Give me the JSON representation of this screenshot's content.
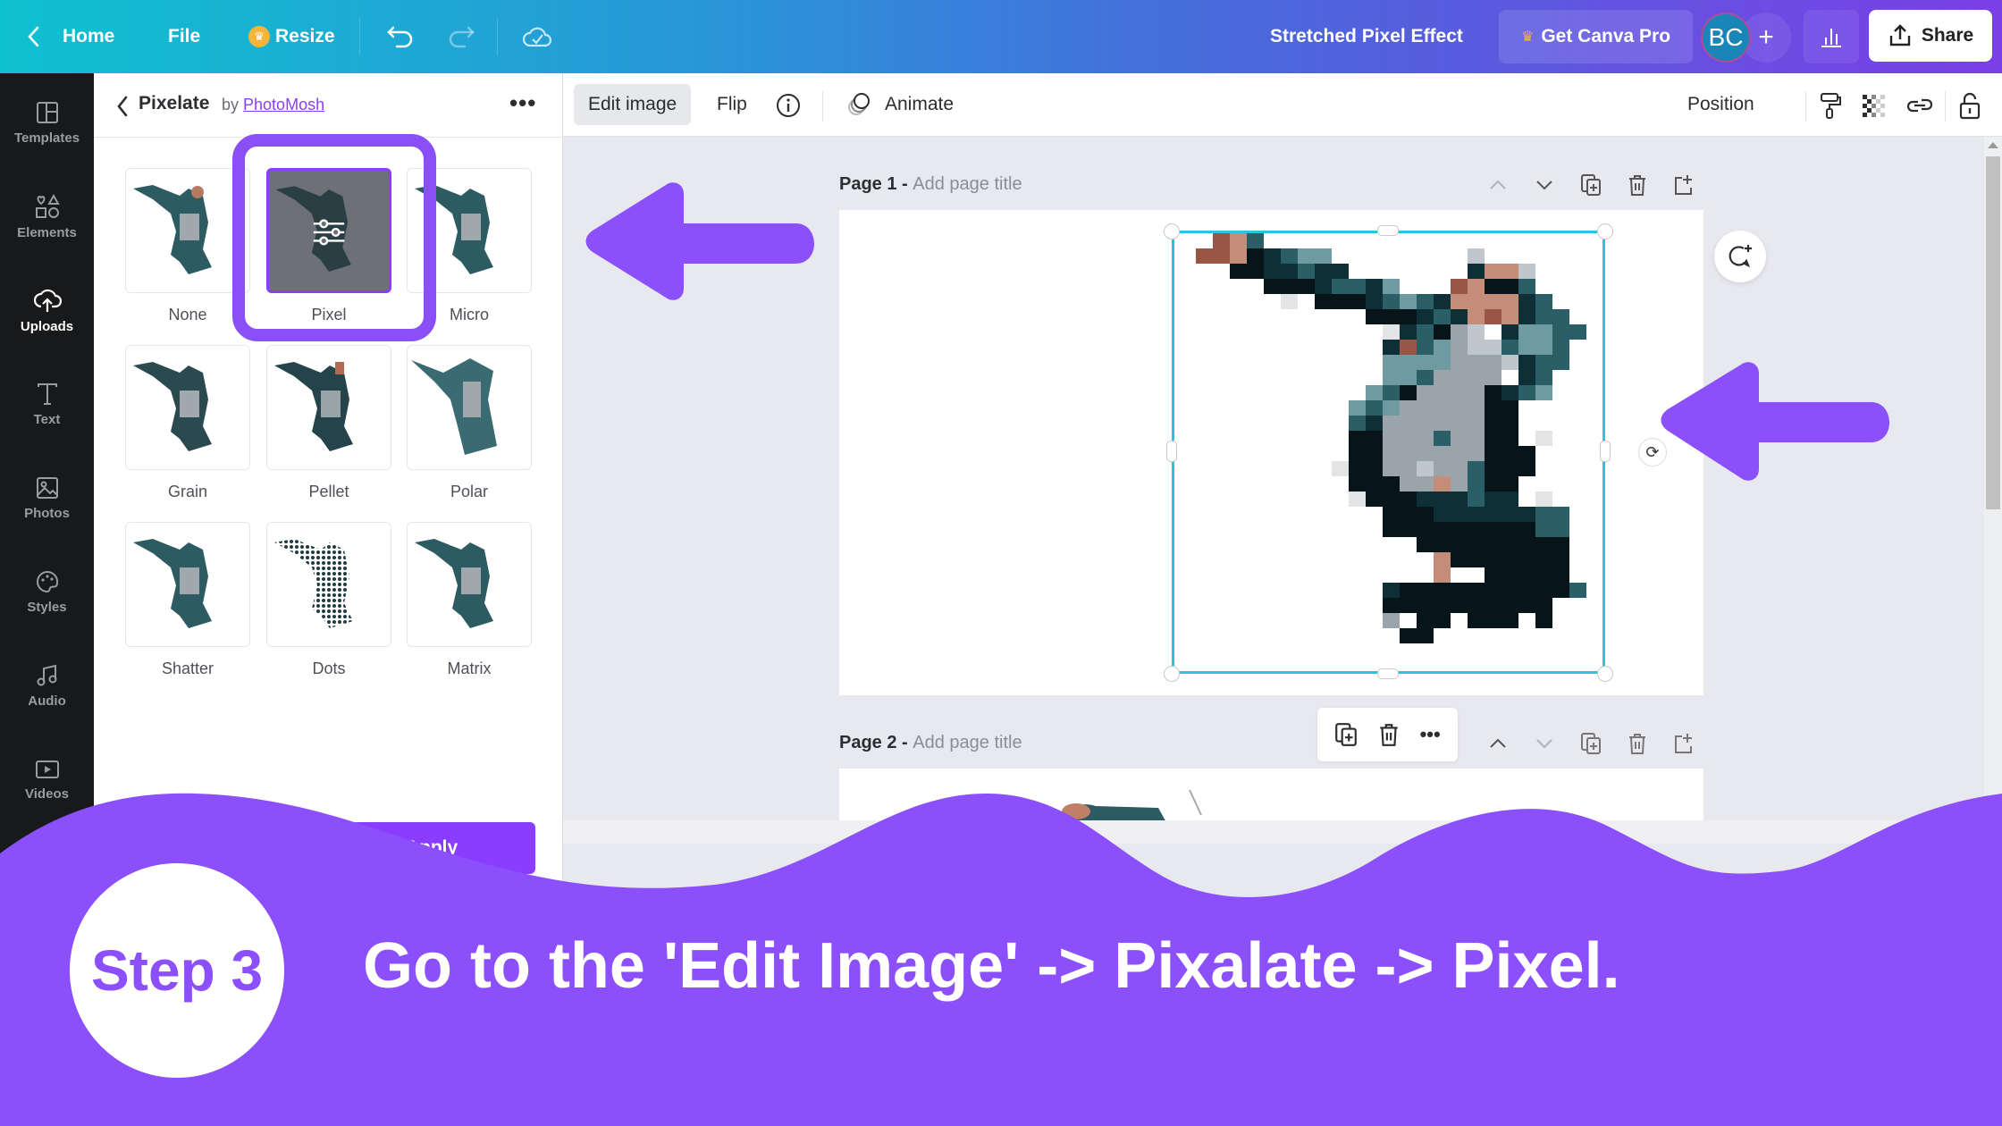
{
  "header": {
    "home_label": "Home",
    "file_label": "File",
    "resize_label": "Resize",
    "doc_title": "Stretched Pixel Effect",
    "get_pro_label": "Get Canva Pro",
    "avatar_initials": "BC",
    "share_label": "Share"
  },
  "sidebar": {
    "items": [
      {
        "label": "Templates",
        "icon": "templates-icon"
      },
      {
        "label": "Elements",
        "icon": "elements-icon"
      },
      {
        "label": "Uploads",
        "icon": "uploads-icon"
      },
      {
        "label": "Text",
        "icon": "text-icon"
      },
      {
        "label": "Photos",
        "icon": "photos-icon"
      },
      {
        "label": "Styles",
        "icon": "styles-icon"
      },
      {
        "label": "Audio",
        "icon": "audio-icon"
      },
      {
        "label": "Videos",
        "icon": "videos-icon"
      }
    ],
    "active": "Uploads"
  },
  "panel": {
    "title": "Pixelate",
    "by_prefix": "by",
    "by_link": "PhotoMosh",
    "effects": [
      {
        "label": "None"
      },
      {
        "label": "Pixel"
      },
      {
        "label": "Micro"
      },
      {
        "label": "Grain"
      },
      {
        "label": "Pellet"
      },
      {
        "label": "Polar"
      },
      {
        "label": "Shatter"
      },
      {
        "label": "Dots"
      },
      {
        "label": "Matrix"
      }
    ],
    "selected_effect": "Pixel",
    "apply_label": "Apply"
  },
  "toolbar": {
    "edit_image_label": "Edit image",
    "flip_label": "Flip",
    "animate_label": "Animate",
    "position_label": "Position"
  },
  "pages": [
    {
      "label": "Page 1 -",
      "title_placeholder": "Add page title"
    },
    {
      "label": "Page 2 -",
      "title_placeholder": "Add page title"
    }
  ],
  "banner": {
    "step_label": "Step 3",
    "instruction": "Go to the 'Edit Image' -> Pixalate -> Pixel."
  },
  "colors": {
    "accent": "#8b3dff",
    "banner": "#8b50fb",
    "selection": "#28c6d6"
  }
}
